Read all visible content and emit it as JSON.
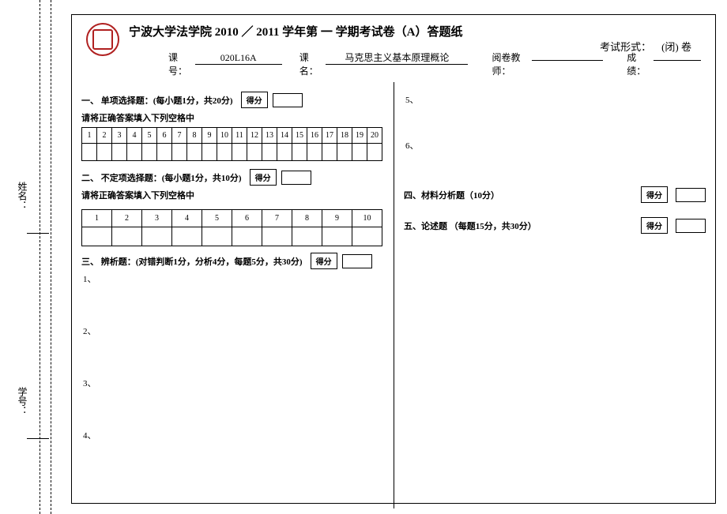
{
  "binding": {
    "name_label": "姓名：",
    "id_label": "学号："
  },
  "header": {
    "title": "宁波大学法学院 2010 ／ 2011 学年第 一 学期考试卷（A）答题纸",
    "form_label": "考试形式：",
    "form_value": "(闭)  卷",
    "course_code_label": "课号：",
    "course_code": "020L16A",
    "course_name_label": "课名：",
    "course_name": "马克思主义基本原理概论",
    "grader_label": "阅卷教师：",
    "score_label_txt": "成绩："
  },
  "score_box_label": "得分",
  "sections": {
    "s1_title": "一、 单项选择题：(每小题1分，共20分)",
    "s1_sub": "请将正确答案填入下列空格中",
    "s2_title": "二、 不定项选择题：(每小题1分，共10分)",
    "s2_sub": "请将正确答案填入下列空格中",
    "s3_title": "三、 辨析题：(对错判断1分，分析4分，每题5分，共30分)",
    "s4_title": "四、材料分析题（10分）",
    "s5_title": "五、论述题 （每题15分，共30分）"
  },
  "grid20": [
    "1",
    "2",
    "3",
    "4",
    "5",
    "6",
    "7",
    "8",
    "9",
    "10",
    "11",
    "12",
    "13",
    "14",
    "15",
    "16",
    "17",
    "18",
    "19",
    "20"
  ],
  "grid10": [
    "1",
    "2",
    "3",
    "4",
    "5",
    "6",
    "7",
    "8",
    "9",
    "10"
  ],
  "q3": {
    "n1": "1、",
    "n2": "2、",
    "n3": "3、",
    "n4": "4、"
  },
  "qR": {
    "n5": "5、",
    "n6": "6、"
  }
}
